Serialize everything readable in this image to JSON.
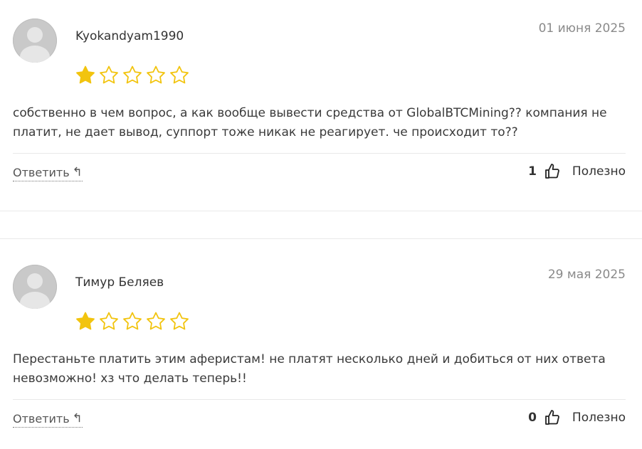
{
  "reviews": [
    {
      "author": "Kyokandyam1990",
      "date": "01 июня 2025",
      "rating": 1,
      "max_rating": 5,
      "text": "собственно в чем вопрос, а как вообще вывести средства от GlobalBTCMining?? компания не платит, не дает вывод, суппорт тоже никак не реагирует. че происходит то??",
      "reply_label": "Ответить",
      "helpful_count": "1",
      "helpful_label": "Полезно"
    },
    {
      "author": "Тимур Беляев",
      "date": "29 мая 2025",
      "rating": 1,
      "max_rating": 5,
      "text": "Перестаньте платить этим аферистам! не платят несколько дней и добиться от них ответа невозможно! хз что делать теперь!!",
      "reply_label": "Ответить",
      "helpful_count": "0",
      "helpful_label": "Полезно"
    }
  ],
  "icons": {
    "avatar": "user-avatar-icon",
    "star_filled": "star-filled-icon",
    "star_empty": "star-outline-icon",
    "reply": "reply-arrow-icon",
    "thumb": "thumbs-up-icon"
  },
  "colors": {
    "star": "#F2C40F",
    "text": "#3a3a3a",
    "date": "#8a8a8a",
    "divider": "#e9e9e9"
  }
}
